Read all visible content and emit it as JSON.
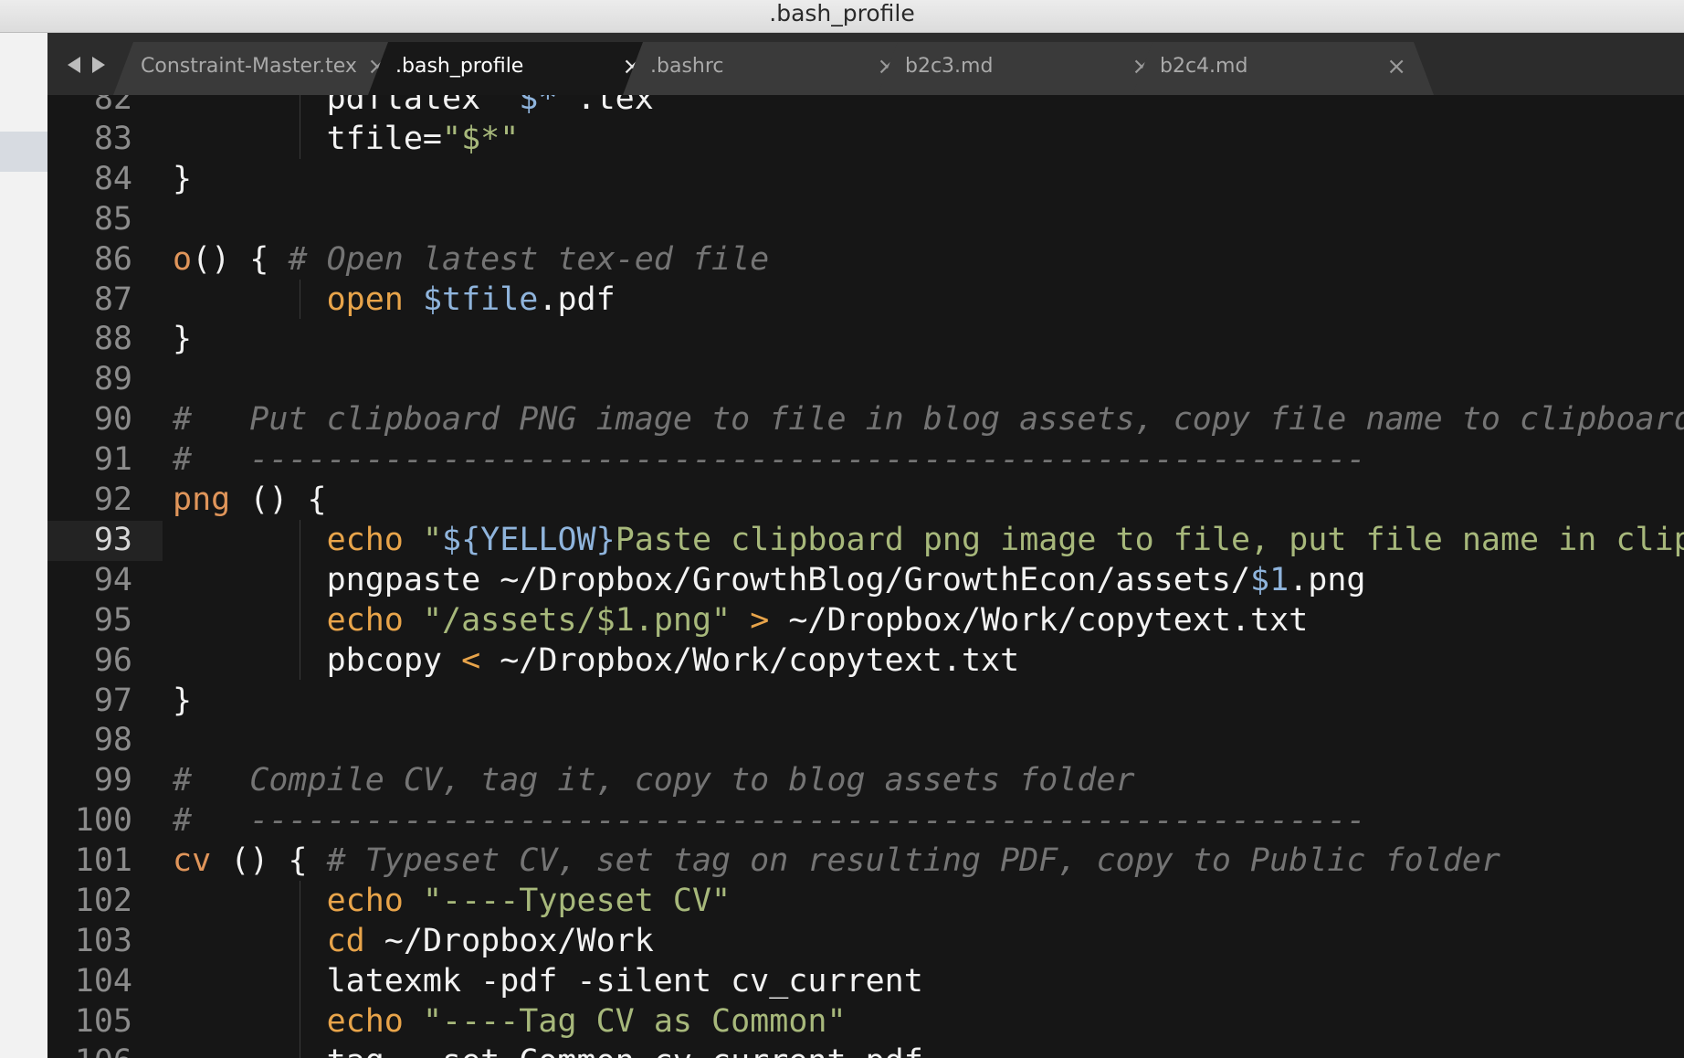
{
  "window": {
    "title": ".bash_profile"
  },
  "tabs": [
    {
      "label": "Constraint-Master.tex",
      "active": false
    },
    {
      "label": ".bash_profile",
      "active": true
    },
    {
      "label": ".bashrc",
      "active": false
    },
    {
      "label": "b2c3.md",
      "active": false
    },
    {
      "label": "b2c4.md",
      "active": false
    }
  ],
  "tab_close_glyph": "×",
  "editor": {
    "current_line": "93",
    "lines": [
      {
        "num": "82",
        "tokens": [
          {
            "t": "        pdflatex \"",
            "c": "plain"
          },
          {
            "t": "$*",
            "c": "var"
          },
          {
            "t": "\".tex",
            "c": "plain"
          }
        ]
      },
      {
        "num": "83",
        "tokens": [
          {
            "t": "        tfile=",
            "c": "plain"
          },
          {
            "t": "\"$*\"",
            "c": "str"
          }
        ]
      },
      {
        "num": "84",
        "tokens": [
          {
            "t": "}",
            "c": "plain"
          }
        ]
      },
      {
        "num": "85",
        "tokens": []
      },
      {
        "num": "86",
        "tokens": [
          {
            "t": "o",
            "c": "fn"
          },
          {
            "t": "() { ",
            "c": "plain"
          },
          {
            "t": "# Open latest tex-ed file",
            "c": "cmt"
          }
        ]
      },
      {
        "num": "87",
        "tokens": [
          {
            "t": "        ",
            "c": "plain"
          },
          {
            "t": "open",
            "c": "kw"
          },
          {
            "t": " ",
            "c": "plain"
          },
          {
            "t": "$tfile",
            "c": "var"
          },
          {
            "t": ".pdf",
            "c": "plain"
          }
        ]
      },
      {
        "num": "88",
        "tokens": [
          {
            "t": "}",
            "c": "plain"
          }
        ]
      },
      {
        "num": "89",
        "tokens": []
      },
      {
        "num": "90",
        "tokens": [
          {
            "t": "#   Put clipboard PNG image to file in blog assets, copy file name to clipboard",
            "c": "cmt"
          }
        ]
      },
      {
        "num": "91",
        "tokens": [
          {
            "t": "#   ----------------------------------------------------------",
            "c": "cmt"
          }
        ]
      },
      {
        "num": "92",
        "tokens": [
          {
            "t": "png",
            "c": "fn"
          },
          {
            "t": " () {",
            "c": "plain"
          }
        ]
      },
      {
        "num": "93",
        "tokens": [
          {
            "t": "        ",
            "c": "plain"
          },
          {
            "t": "echo",
            "c": "kw"
          },
          {
            "t": " ",
            "c": "plain"
          },
          {
            "t": "\"",
            "c": "str"
          },
          {
            "t": "${YELLOW}",
            "c": "var"
          },
          {
            "t": "Paste clipboard png image to file, put file name in clipboard",
            "c": "str"
          }
        ]
      },
      {
        "num": "94",
        "tokens": [
          {
            "t": "        pngpaste ~/Dropbox/GrowthBlog/GrowthEcon/assets/",
            "c": "plain"
          },
          {
            "t": "$1",
            "c": "var"
          },
          {
            "t": ".png",
            "c": "plain"
          }
        ]
      },
      {
        "num": "95",
        "tokens": [
          {
            "t": "        ",
            "c": "plain"
          },
          {
            "t": "echo",
            "c": "kw"
          },
          {
            "t": " ",
            "c": "plain"
          },
          {
            "t": "\"/assets/$1.png\"",
            "c": "str"
          },
          {
            "t": " ",
            "c": "plain"
          },
          {
            "t": ">",
            "c": "op"
          },
          {
            "t": " ~/Dropbox/Work/copytext.txt",
            "c": "plain"
          }
        ]
      },
      {
        "num": "96",
        "tokens": [
          {
            "t": "        pbcopy ",
            "c": "plain"
          },
          {
            "t": "<",
            "c": "op"
          },
          {
            "t": " ~/Dropbox/Work/copytext.txt",
            "c": "plain"
          }
        ]
      },
      {
        "num": "97",
        "tokens": [
          {
            "t": "}",
            "c": "plain"
          }
        ]
      },
      {
        "num": "98",
        "tokens": []
      },
      {
        "num": "99",
        "tokens": [
          {
            "t": "#   Compile CV, tag it, copy to blog assets folder",
            "c": "cmt"
          }
        ]
      },
      {
        "num": "100",
        "tokens": [
          {
            "t": "#   ----------------------------------------------------------",
            "c": "cmt"
          }
        ]
      },
      {
        "num": "101",
        "tokens": [
          {
            "t": "cv",
            "c": "fn"
          },
          {
            "t": " () { ",
            "c": "plain"
          },
          {
            "t": "# Typeset CV, set tag on resulting PDF, copy to Public folder",
            "c": "cmt"
          }
        ]
      },
      {
        "num": "102",
        "tokens": [
          {
            "t": "        ",
            "c": "plain"
          },
          {
            "t": "echo",
            "c": "kw"
          },
          {
            "t": " ",
            "c": "plain"
          },
          {
            "t": "\"----Typeset CV\"",
            "c": "str"
          }
        ]
      },
      {
        "num": "103",
        "tokens": [
          {
            "t": "        ",
            "c": "plain"
          },
          {
            "t": "cd",
            "c": "kw"
          },
          {
            "t": " ~/Dropbox/Work",
            "c": "plain"
          }
        ]
      },
      {
        "num": "104",
        "tokens": [
          {
            "t": "        latexmk -pdf -silent cv_current",
            "c": "plain"
          }
        ]
      },
      {
        "num": "105",
        "tokens": [
          {
            "t": "        ",
            "c": "plain"
          },
          {
            "t": "echo",
            "c": "kw"
          },
          {
            "t": " ",
            "c": "plain"
          },
          {
            "t": "\"----Tag CV as Common\"",
            "c": "str"
          }
        ]
      },
      {
        "num": "106",
        "tokens": [
          {
            "t": "        tag --set Common cv_current.pdf",
            "c": "plain"
          }
        ]
      }
    ]
  }
}
